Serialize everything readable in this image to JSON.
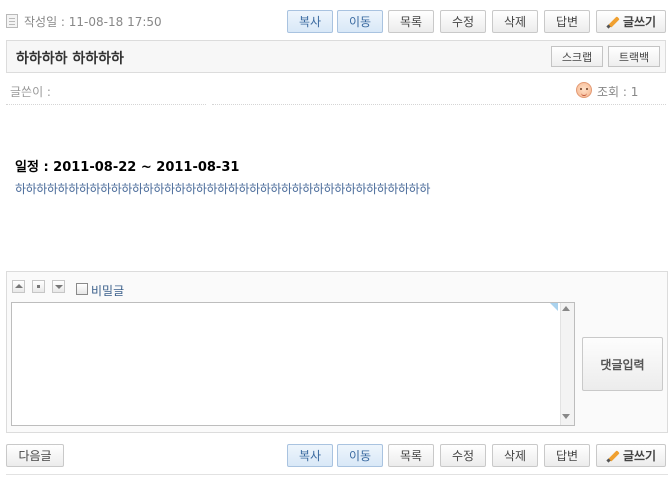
{
  "post": {
    "date_label": "작성일 : 11-08-18 17:50",
    "title": "하하하하 하하하하",
    "author_label": "글쓴이 :",
    "views_label": "조회 : 1",
    "schedule": "일정 : 2011-08-22 ~ 2011-08-31",
    "content": "하하하하하하하하하하하하하하하하하하하하하하하하하하하하하하하하하하하하하하하"
  },
  "toolbar_top": {
    "copy": "복사",
    "move": "이동",
    "list": "목록",
    "edit": "수정",
    "delete": "삭제",
    "reply": "답변",
    "write": "글쓰기"
  },
  "title_actions": {
    "scrap": "스크랩",
    "trackback": "트랙백"
  },
  "comment": {
    "secret_label": "비밀글",
    "text_value": "",
    "submit": "댓글입력"
  },
  "toolbar_bottom": {
    "next": "다음글",
    "copy": "복사",
    "move": "이동",
    "list": "목록",
    "edit": "수정",
    "delete": "삭제",
    "reply": "답변",
    "write": "글쓰기"
  },
  "colors": {
    "accent_button": "#d9e8f7",
    "accent_text": "#3a6aa0",
    "content_text": "#4a6b9a"
  },
  "icons": [
    "document-icon",
    "pencil-icon",
    "face-icon",
    "arrow-up-icon",
    "square-icon",
    "arrow-down-icon",
    "checkbox-icon"
  ]
}
